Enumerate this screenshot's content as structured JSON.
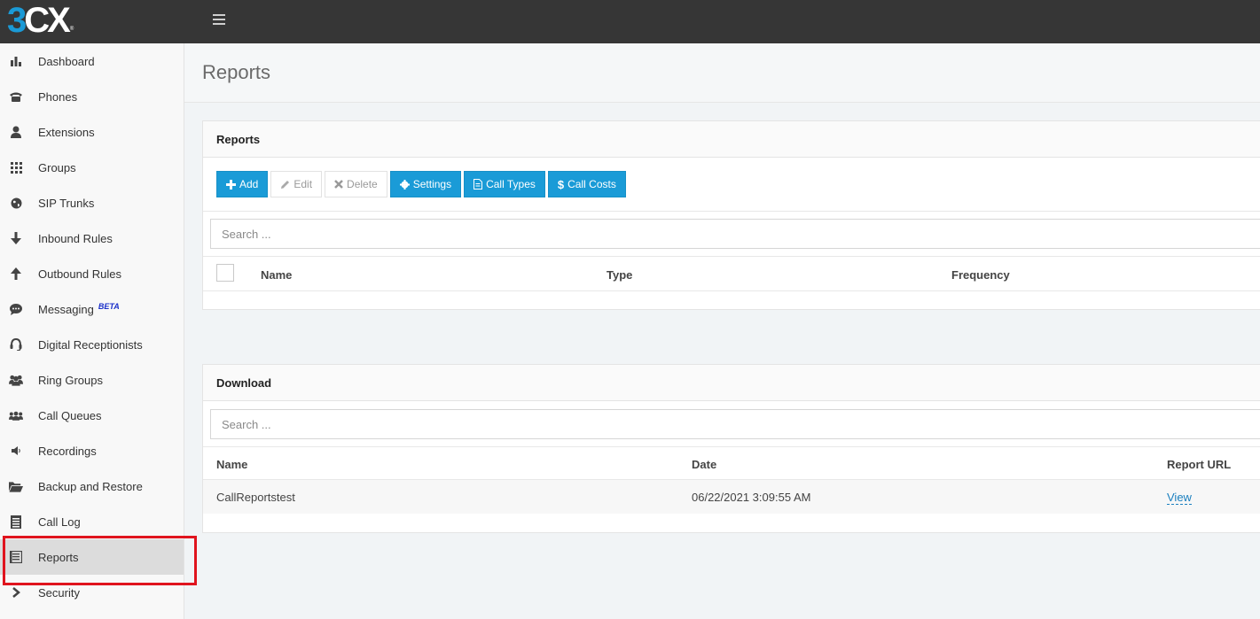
{
  "app": {
    "logo_three": "3",
    "logo_cx": "CX",
    "logo_reg": "®"
  },
  "sidebar": {
    "items": [
      {
        "label": "Dashboard",
        "icon": "bar-chart-icon"
      },
      {
        "label": "Phones",
        "icon": "phone-icon"
      },
      {
        "label": "Extensions",
        "icon": "user-icon"
      },
      {
        "label": "Groups",
        "icon": "grid-icon"
      },
      {
        "label": "SIP Trunks",
        "icon": "globe-icon"
      },
      {
        "label": "Inbound Rules",
        "icon": "arrow-down-icon"
      },
      {
        "label": "Outbound Rules",
        "icon": "arrow-up-icon"
      },
      {
        "label": "Messaging",
        "icon": "chat-icon",
        "badge": "BETA"
      },
      {
        "label": "Digital Receptionists",
        "icon": "headset-icon"
      },
      {
        "label": "Ring Groups",
        "icon": "users-icon"
      },
      {
        "label": "Call Queues",
        "icon": "queue-icon"
      },
      {
        "label": "Recordings",
        "icon": "speaker-icon"
      },
      {
        "label": "Backup and Restore",
        "icon": "folder-open-icon"
      },
      {
        "label": "Call Log",
        "icon": "log-icon"
      },
      {
        "label": "Reports",
        "icon": "report-icon",
        "active": true
      },
      {
        "label": "Security",
        "icon": "chevron-right-icon"
      }
    ]
  },
  "page": {
    "title": "Reports"
  },
  "reports_panel": {
    "title": "Reports",
    "buttons": {
      "add": "Add",
      "edit": "Edit",
      "delete": "Delete",
      "settings": "Settings",
      "call_types": "Call Types",
      "call_costs": "Call Costs"
    },
    "search_placeholder": "Search ...",
    "columns": [
      "Name",
      "Type",
      "Frequency"
    ]
  },
  "download_panel": {
    "title": "Download",
    "search_placeholder": "Search ...",
    "columns": [
      "Name",
      "Date",
      "Report URL"
    ],
    "rows": [
      {
        "name": "CallReportstest",
        "date": "06/22/2021 3:09:55 AM",
        "url_label": "View"
      }
    ]
  },
  "colors": {
    "topbar": "#363636",
    "accent": "#1a9bd7",
    "highlight": "#e0141e"
  }
}
